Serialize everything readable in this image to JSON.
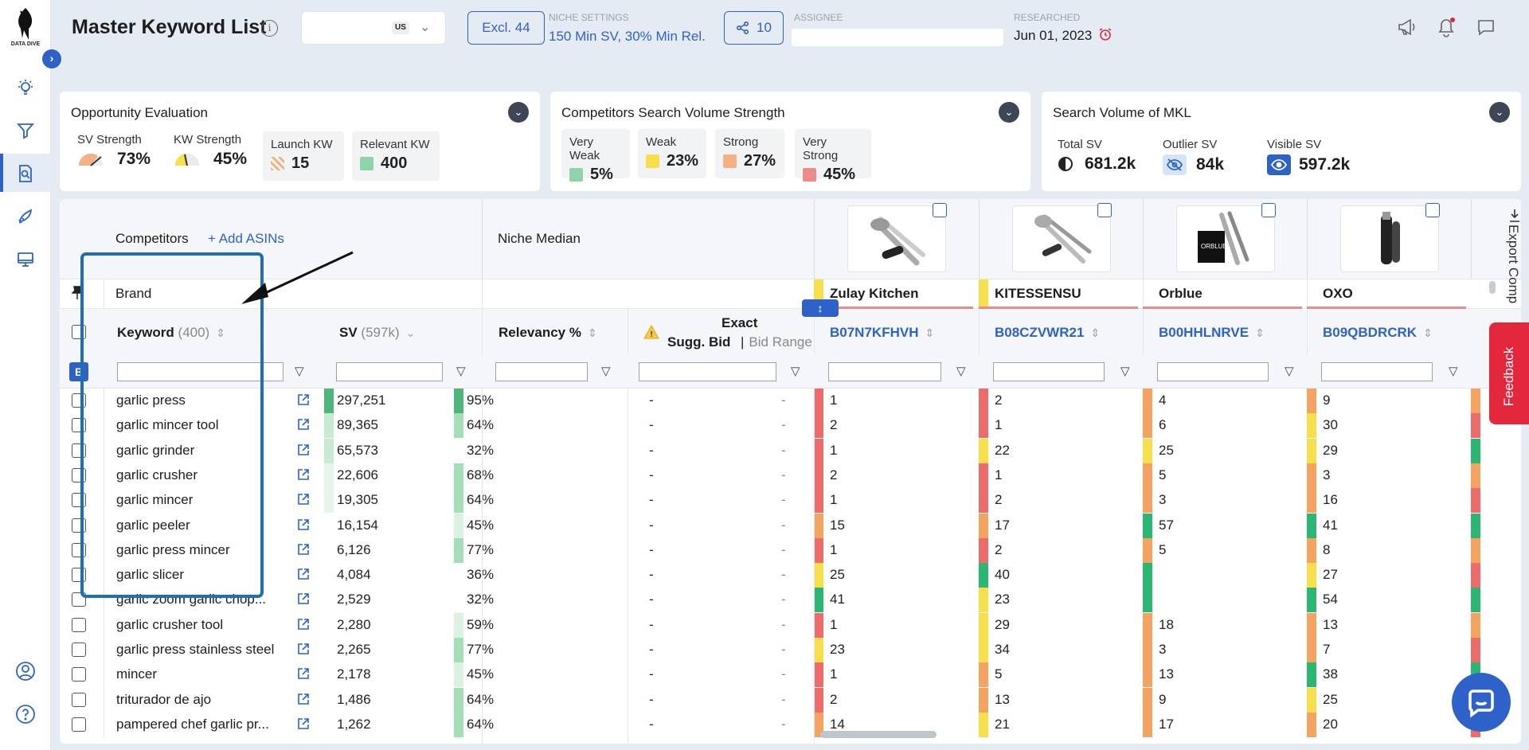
{
  "app": {
    "logo_text": "DATA DIVE"
  },
  "header": {
    "title": "Master Keyword List",
    "market": "US",
    "excl_label": "Excl. 44",
    "niche_settings_caption": "NICHE SETTINGS",
    "niche_settings_value": "150 Min SV, 30% Min Rel.",
    "share_count": "10",
    "assignee_caption": "ASSIGNEE",
    "researched_caption": "RESEARCHED",
    "researched_date": "Jun 01, 2023"
  },
  "cards": {
    "opportunity": {
      "title": "Opportunity Evaluation",
      "sv_strength_label": "SV Strength",
      "sv_strength_value": "73%",
      "kw_strength_label": "KW Strength",
      "kw_strength_value": "45%",
      "launch_kw_label": "Launch KW",
      "launch_kw_value": "15",
      "relevant_kw_label": "Relevant KW",
      "relevant_kw_value": "400"
    },
    "competitors": {
      "title": "Competitors Search Volume Strength",
      "very_weak_label": "Very Weak",
      "very_weak_value": "5%",
      "weak_label": "Weak",
      "weak_value": "23%",
      "strong_label": "Strong",
      "strong_value": "27%",
      "very_strong_label": "Very Strong",
      "very_strong_value": "45%"
    },
    "search_volume": {
      "title": "Search Volume of MKL",
      "total_label": "Total SV",
      "total_value": "681.2k",
      "outlier_label": "Outlier SV",
      "outlier_value": "84k",
      "visible_label": "Visible SV",
      "visible_value": "597.2k"
    }
  },
  "table": {
    "competitors_label": "Competitors",
    "add_asins_label": "+ Add ASINs",
    "niche_median_label": "Niche Median",
    "brand_label": "Brand",
    "keyword_header": "Keyword",
    "keyword_count": "(400)",
    "sv_header": "SV",
    "sv_total": "(597k)",
    "relevancy_header": "Relevancy %",
    "exact_label": "Exact",
    "sugg_bid_label": "Sugg. Bid",
    "bid_range_label": "Bid Range",
    "b_badge": "B",
    "export_label": "Export Comp",
    "feedback_label": "Feedback",
    "competitors": [
      {
        "brand": "Zulay Kitchen",
        "asin": "B07N7KFHVH",
        "brand_color": "#f5d64a"
      },
      {
        "brand": "KITESSENSU",
        "asin": "B08CZVWR21",
        "brand_color": "#f5d64a"
      },
      {
        "brand": "Orblue",
        "asin": "B00HHLNRVE",
        "brand_color": "#f4b183"
      },
      {
        "brand": "OXO",
        "asin": "B09QBDRCRK",
        "brand_color": "#f4b183"
      }
    ],
    "rows": [
      {
        "kw": "garlic press",
        "sv": "297,251",
        "rel": "95%",
        "bid": "-",
        "range": "-",
        "r": [
          "1",
          "2",
          "4",
          "9"
        ]
      },
      {
        "kw": "garlic mincer tool",
        "sv": "89,365",
        "rel": "64%",
        "bid": "-",
        "range": "-",
        "r": [
          "2",
          "1",
          "6",
          "30"
        ]
      },
      {
        "kw": "garlic grinder",
        "sv": "65,573",
        "rel": "32%",
        "bid": "-",
        "range": "-",
        "r": [
          "1",
          "22",
          "25",
          "29"
        ]
      },
      {
        "kw": "garlic crusher",
        "sv": "22,606",
        "rel": "68%",
        "bid": "-",
        "range": "-",
        "r": [
          "2",
          "1",
          "5",
          "3"
        ]
      },
      {
        "kw": "garlic mincer",
        "sv": "19,305",
        "rel": "64%",
        "bid": "-",
        "range": "-",
        "r": [
          "1",
          "2",
          "3",
          "16"
        ]
      },
      {
        "kw": "garlic peeler",
        "sv": "16,154",
        "rel": "45%",
        "bid": "-",
        "range": "-",
        "r": [
          "15",
          "17",
          "57",
          "41"
        ]
      },
      {
        "kw": "garlic press mincer",
        "sv": "6,126",
        "rel": "77%",
        "bid": "-",
        "range": "-",
        "r": [
          "1",
          "2",
          "5",
          "8"
        ]
      },
      {
        "kw": "garlic slicer",
        "sv": "4,084",
        "rel": "36%",
        "bid": "-",
        "range": "-",
        "r": [
          "25",
          "40",
          "",
          "27"
        ]
      },
      {
        "kw": "garlic zoom garlic chop...",
        "sv": "2,529",
        "rel": "32%",
        "bid": "-",
        "range": "-",
        "r": [
          "41",
          "23",
          "",
          "54"
        ]
      },
      {
        "kw": "garlic crusher tool",
        "sv": "2,280",
        "rel": "59%",
        "bid": "-",
        "range": "-",
        "r": [
          "1",
          "29",
          "18",
          "13"
        ]
      },
      {
        "kw": "garlic press stainless steel",
        "sv": "2,265",
        "rel": "77%",
        "bid": "-",
        "range": "-",
        "r": [
          "23",
          "34",
          "3",
          "7"
        ]
      },
      {
        "kw": "mincer",
        "sv": "2,178",
        "rel": "45%",
        "bid": "-",
        "range": "-",
        "r": [
          "1",
          "5",
          "13",
          "38"
        ]
      },
      {
        "kw": "triturador de ajo",
        "sv": "1,486",
        "rel": "64%",
        "bid": "-",
        "range": "-",
        "r": [
          "2",
          "13",
          "9",
          "25"
        ]
      },
      {
        "kw": "pampered chef garlic pr...",
        "sv": "1,262",
        "rel": "64%",
        "bid": "-",
        "range": "-",
        "r": [
          "14",
          "21",
          "17",
          "20"
        ]
      }
    ]
  },
  "colors": {
    "accent": "#2e62c9",
    "highlight": "#1e6fb8",
    "red": "#ee6b6b",
    "orange": "#f4a460",
    "yellow": "#f7de4b",
    "green": "#2bb673"
  },
  "icons": [
    "logo-icon",
    "expand-icon",
    "lightbulb-icon",
    "filter-icon",
    "search-doc-icon",
    "rocket-icon",
    "monitor-icon",
    "user-icon",
    "help-icon",
    "info-icon",
    "share-icon",
    "alarm-icon",
    "megaphone-icon",
    "bell-icon",
    "chat-icon",
    "pin-icon",
    "external-link-icon",
    "filter-small-icon",
    "warning-icon",
    "arrow-annotation"
  ]
}
